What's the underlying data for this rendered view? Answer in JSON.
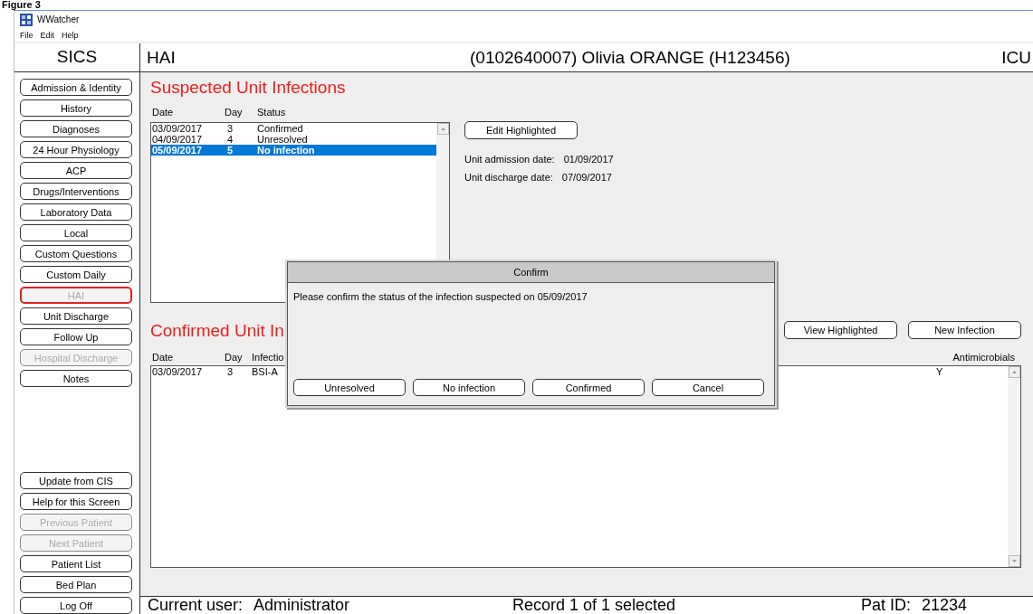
{
  "figure_caption": "Figure 3",
  "window": {
    "title": "WWatcher"
  },
  "menu": [
    "File",
    "Edit",
    "Help"
  ],
  "header": {
    "app": "SICS",
    "screen": "HAI",
    "patient": "(0102640007) Olivia ORANGE (H123456)",
    "unit": "ICU"
  },
  "sidebar": {
    "items": [
      {
        "label": "Admission & Identity",
        "selected": false,
        "disabled": false
      },
      {
        "label": "History",
        "selected": false,
        "disabled": false
      },
      {
        "label": "Diagnoses",
        "selected": false,
        "disabled": false
      },
      {
        "label": "24 Hour Physiology",
        "selected": false,
        "disabled": false
      },
      {
        "label": "ACP",
        "selected": false,
        "disabled": false
      },
      {
        "label": "Drugs/Interventions",
        "selected": false,
        "disabled": false
      },
      {
        "label": "Laboratory Data",
        "selected": false,
        "disabled": false
      },
      {
        "label": "Local",
        "selected": false,
        "disabled": false
      },
      {
        "label": "Custom Questions",
        "selected": false,
        "disabled": false
      },
      {
        "label": "Custom Daily",
        "selected": false,
        "disabled": false
      },
      {
        "label": "HAI",
        "selected": true,
        "disabled": true
      },
      {
        "label": "Unit Discharge",
        "selected": false,
        "disabled": false
      },
      {
        "label": "Follow Up",
        "selected": false,
        "disabled": false
      },
      {
        "label": "Hospital Discharge",
        "selected": false,
        "disabled": true
      },
      {
        "label": "Notes",
        "selected": false,
        "disabled": false
      }
    ],
    "bottom_items": [
      {
        "label": "Update from CIS",
        "disabled": false
      },
      {
        "label": "Help for this Screen",
        "disabled": false
      },
      {
        "label": "Previous Patient",
        "disabled": true
      },
      {
        "label": "Next Patient",
        "disabled": true
      },
      {
        "label": "Patient List",
        "disabled": false
      },
      {
        "label": "Bed Plan",
        "disabled": false
      },
      {
        "label": "Log Off",
        "disabled": false
      }
    ]
  },
  "suspected": {
    "title": "Suspected Unit Infections",
    "columns": [
      "Date",
      "Day",
      "Status"
    ],
    "rows": [
      {
        "date": "03/09/2017",
        "day": "3",
        "status": "Confirmed",
        "selected": false
      },
      {
        "date": "04/09/2017",
        "day": "4",
        "status": "Unresolved",
        "selected": false
      },
      {
        "date": "05/09/2017",
        "day": "5",
        "status": "No infection",
        "selected": true
      }
    ],
    "edit_button": "Edit Highlighted",
    "admission": {
      "label": "Unit admission date:",
      "value": "01/09/2017"
    },
    "discharge": {
      "label": "Unit discharge date:",
      "value": "07/09/2017"
    }
  },
  "confirmed": {
    "title": "Confirmed Unit In",
    "buttons": [
      "View Highlighted",
      "New Infection"
    ],
    "columns": [
      "Date",
      "Day",
      "Infectio",
      "Antimicrobials"
    ],
    "rows": [
      {
        "date": "03/09/2017",
        "day": "3",
        "infection": "BSI-A",
        "antimicrobials": "Y",
        "selected": false
      }
    ]
  },
  "dialog": {
    "title": "Confirm",
    "message": "Please confirm the status of the infection suspected on 05/09/2017",
    "buttons": [
      "Unresolved",
      "No infection",
      "Confirmed",
      "Cancel"
    ]
  },
  "status_bar": {
    "user_label": "Current user:",
    "user": "Administrator",
    "record": "Record 1 of 1 selected",
    "pat_id_label": "Pat ID:",
    "pat_id": "21234"
  }
}
